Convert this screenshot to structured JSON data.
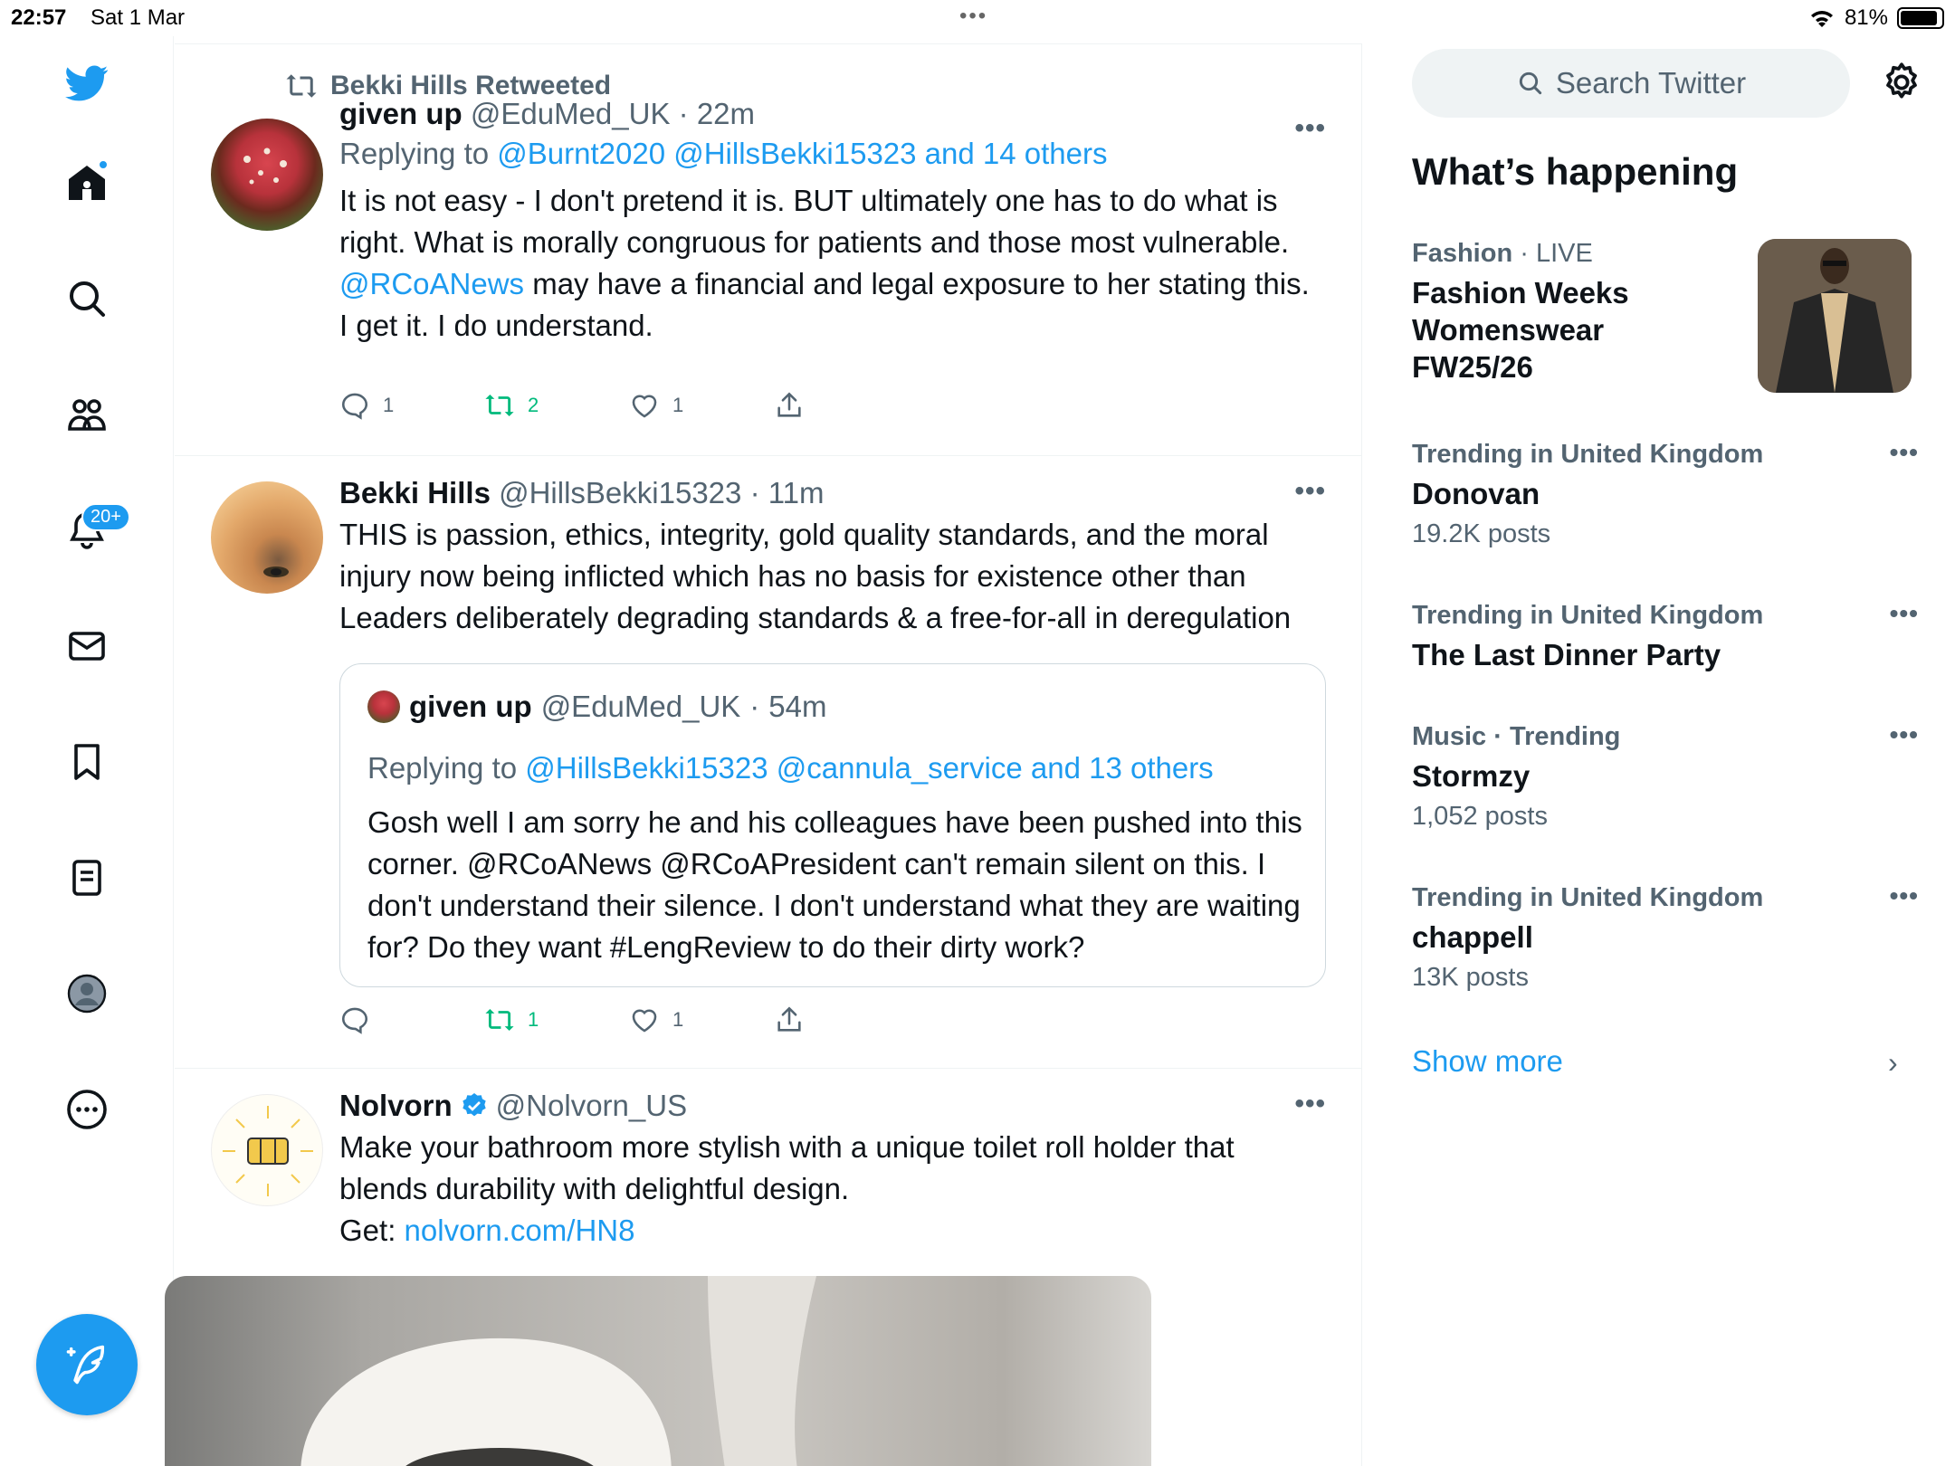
{
  "status_bar": {
    "time": "22:57",
    "date": "Sat 1 Mar",
    "battery": "81%",
    "battery_level": 0.81
  },
  "nav": {
    "notifications_badge": "20+",
    "icons": [
      "twitter-logo-icon",
      "home-icon",
      "search-icon",
      "communities-icon",
      "notifications-icon",
      "messages-icon",
      "bookmarks-icon",
      "lists-icon",
      "profile-icon",
      "more-icon",
      "compose-icon"
    ]
  },
  "feed": {
    "tweets": [
      {
        "retweeted_by": "Bekki Hills Retweeted",
        "name": "given up",
        "handle": "@EduMed_UK",
        "time": "22m",
        "replying_prefix": "Replying to ",
        "replying_to": "@Burnt2020 @HillsBekki15323 and 14 others",
        "text_before": "It is not easy - I don't pretend it is. BUT ultimately one has to do what is right. What is morally congruous for patients and those most vulnerable. ",
        "mention": "@RCoANews",
        "text_after": " may have a financial and legal exposure to her stating this. I get it. I do understand.",
        "replies": "1",
        "retweets": "2",
        "likes": "1"
      },
      {
        "name": "Bekki Hills",
        "handle": "@HillsBekki15323",
        "time": "11m",
        "text": "THIS is passion, ethics, integrity, gold quality standards, and the moral injury now being inflicted which has no basis for existence other than Leaders deliberately degrading standards & a free-for-all in deregulation",
        "quote": {
          "name": "given up",
          "handle": "@EduMed_UK",
          "time": "54m",
          "replying_prefix": "Replying to ",
          "replying_to": "@HillsBekki15323 @cannula_service and 13 others",
          "text": "Gosh well I am sorry he and his colleagues have been pushed into this corner. @RCoANews @RCoAPresident can't remain silent on this. I don't understand their silence. I don't understand what they are waiting for? Do they want #LengReview to do their dirty work?"
        },
        "replies": "",
        "retweets": "1",
        "likes": "1"
      },
      {
        "name": "Nolvorn",
        "handle": "@Nolvorn_US",
        "verified": true,
        "text": "Make your bathroom more stylish with a unique toilet roll holder that blends durability with delightful design.",
        "get_prefix": "Get: ",
        "link": "nolvorn.com/HN8"
      }
    ]
  },
  "sidebar": {
    "search_placeholder": "Search Twitter",
    "title": "What’s happening",
    "trends": [
      {
        "category": "Fashion",
        "context": "LIVE",
        "title_lines": [
          "Fashion Weeks",
          "Womenswear",
          "FW25/26"
        ]
      },
      {
        "category": "Trending in United Kingdom",
        "title": "Donovan",
        "posts": "19.2K posts"
      },
      {
        "category": "Trending in United Kingdom",
        "title": "The Last Dinner Party"
      },
      {
        "category": "Music · Trending",
        "title": "Stormzy",
        "posts": "1,052 posts"
      },
      {
        "category": "Trending in United Kingdom",
        "title": "chappell",
        "posts": "13K posts"
      }
    ],
    "show_more": "Show more"
  },
  "colors": {
    "accent": "#1d9bf0",
    "retweet_green": "#00ba7c",
    "secondary_text": "#536471"
  }
}
